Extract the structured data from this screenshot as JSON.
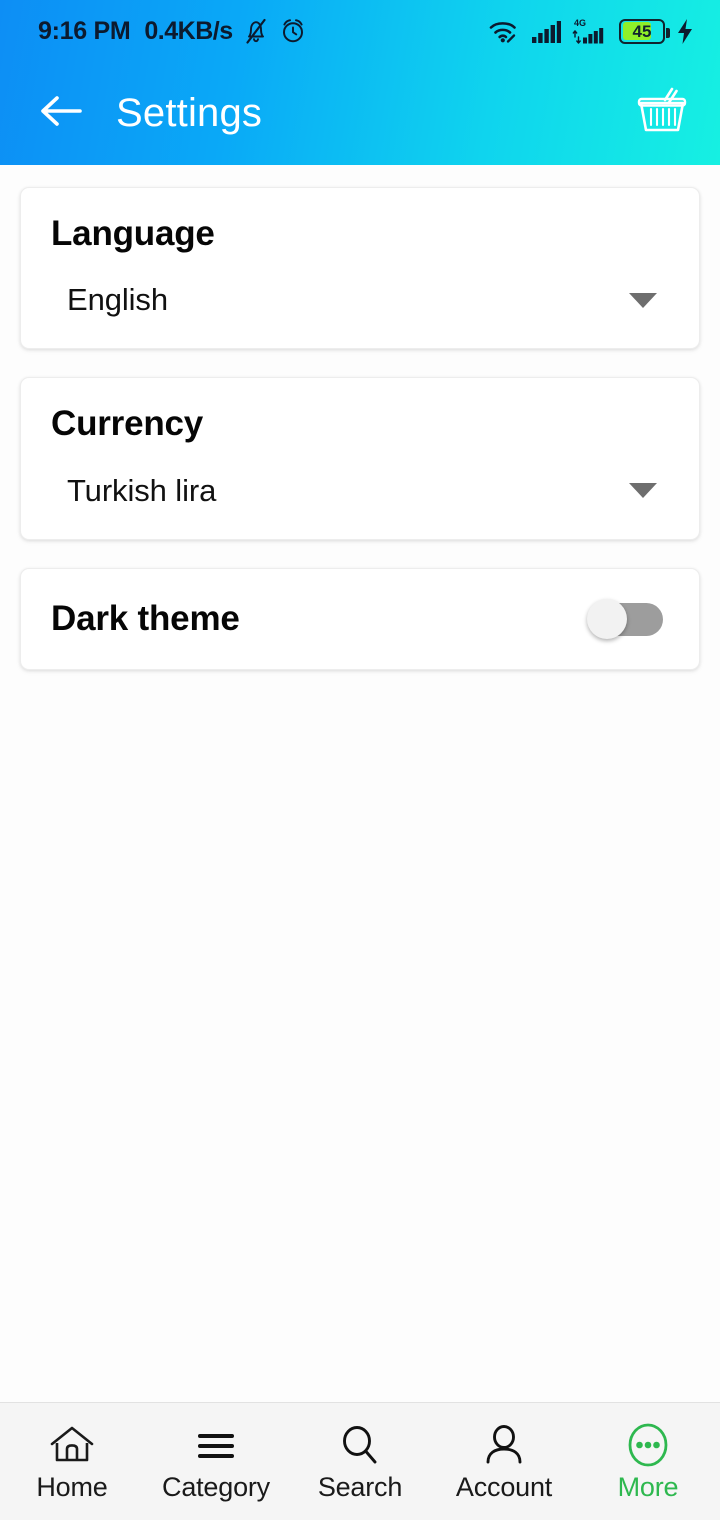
{
  "statusbar": {
    "time": "9:16 PM",
    "network_speed": "0.4KB/s",
    "icons": [
      "bell-muted-icon",
      "alarm-clock-icon",
      "wifi-icon",
      "signal-bars-icon",
      "signal-4g-icon"
    ],
    "network_type": "4G",
    "battery_level": "45",
    "battery_charging": true,
    "battery_fill_color": "#8ff029",
    "text_color": "#0c1a2e"
  },
  "header": {
    "title": "Settings",
    "back_icon": "back-arrow-icon",
    "cart_icon": "shopping-basket-icon",
    "gradient_start": "#0d8ef5",
    "gradient_end": "#16f0e2",
    "title_color": "#ffffff"
  },
  "settings": {
    "language": {
      "title": "Language",
      "value": "English",
      "caret_icon": "chevron-down-icon"
    },
    "currency": {
      "title": "Currency",
      "value": "Turkish lira",
      "caret_icon": "chevron-down-icon"
    },
    "dark_theme": {
      "title": "Dark theme",
      "enabled": false,
      "track_color": "#9d9d9d",
      "knob_color": "#f2f2f2"
    }
  },
  "bottomnav": {
    "active_index": 4,
    "active_color": "#2eb84f",
    "items": [
      {
        "label": "Home",
        "icon": "home-icon"
      },
      {
        "label": "Category",
        "icon": "menu-lines-icon"
      },
      {
        "label": "Search",
        "icon": "search-icon"
      },
      {
        "label": "Account",
        "icon": "person-icon"
      },
      {
        "label": "More",
        "icon": "more-dots-circle-icon"
      }
    ]
  }
}
